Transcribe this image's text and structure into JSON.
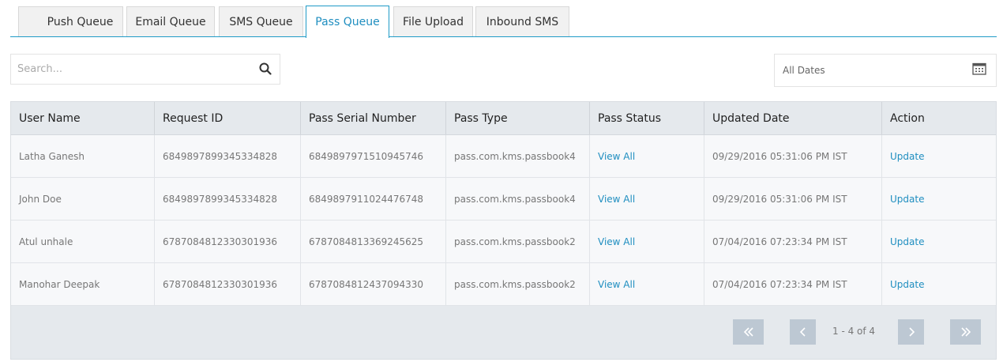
{
  "tabs": [
    {
      "label": "Push Queue"
    },
    {
      "label": "Email Queue"
    },
    {
      "label": "SMS Queue"
    },
    {
      "label": "Pass Queue"
    },
    {
      "label": "File Upload"
    },
    {
      "label": "Inbound SMS"
    }
  ],
  "active_tab": "Pass Queue",
  "search": {
    "placeholder": "Search...",
    "icon": "search-icon"
  },
  "date_filter": {
    "label": "All Dates",
    "icon": "calendar-icon"
  },
  "table": {
    "columns": [
      "User Name",
      "Request ID",
      "Pass Serial Number",
      "Pass Type",
      "Pass Status",
      "Updated Date",
      "Action"
    ],
    "rows": [
      {
        "user": "Latha Ganesh",
        "request_id": "6849897899345334828",
        "serial": "6849897971510945746",
        "type": "pass.com.kms.passbook4",
        "status": "View All",
        "updated": "09/29/2016 05:31:06 PM IST",
        "action": "Update"
      },
      {
        "user": "John Doe",
        "request_id": "6849897899345334828",
        "serial": "6849897911024476748",
        "type": "pass.com.kms.passbook4",
        "status": "View All",
        "updated": "09/29/2016 05:31:06 PM IST",
        "action": "Update"
      },
      {
        "user": "Atul unhale",
        "request_id": "6787084812330301936",
        "serial": "6787084813369245625",
        "type": "pass.com.kms.passbook2",
        "status": "View All",
        "updated": "07/04/2016 07:23:34 PM IST",
        "action": "Update"
      },
      {
        "user": "Manohar Deepak",
        "request_id": "6787084812330301936",
        "serial": "6787084812437094330",
        "type": "pass.com.kms.passbook2",
        "status": "View All",
        "updated": "07/04/2016 07:23:34 PM IST",
        "action": "Update"
      }
    ]
  },
  "pagination": {
    "info": "1 - 4 of 4"
  },
  "colors": {
    "accent": "#1f8ec0",
    "header_bg": "#e5e9ed",
    "pager_button": "#bdc8d3"
  }
}
